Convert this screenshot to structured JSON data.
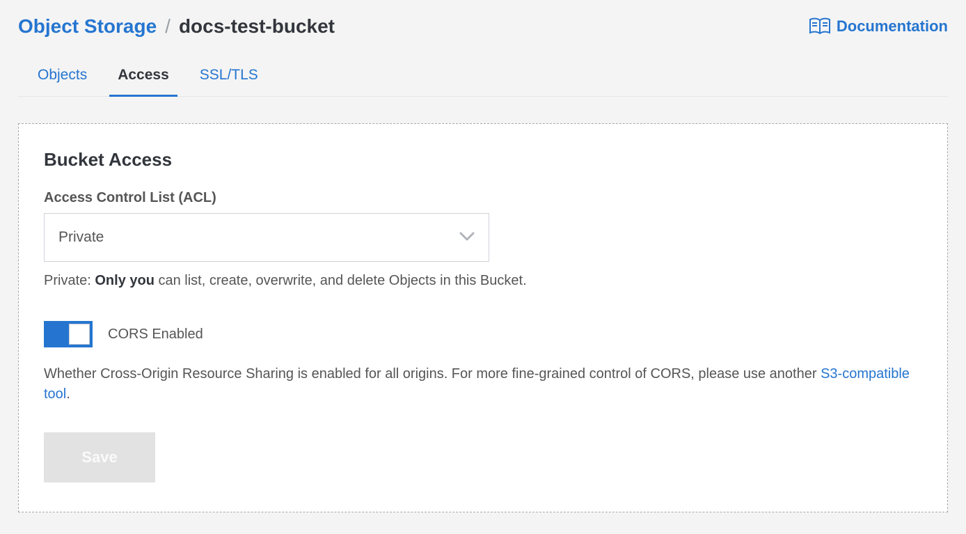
{
  "breadcrumb": {
    "root": "Object Storage",
    "separator": "/",
    "current": "docs-test-bucket"
  },
  "header": {
    "doc_link": "Documentation"
  },
  "tabs": [
    {
      "label": "Objects",
      "active": false
    },
    {
      "label": "Access",
      "active": true
    },
    {
      "label": "SSL/TLS",
      "active": false
    }
  ],
  "panel": {
    "title": "Bucket Access",
    "acl": {
      "label": "Access Control List (ACL)",
      "selected": "Private",
      "helper_prefix": "Private: ",
      "helper_strong": "Only you",
      "helper_rest": " can list, create, overwrite, and delete Objects in this Bucket."
    },
    "cors": {
      "enabled": true,
      "toggle_label": "CORS Enabled",
      "desc_1": "Whether Cross-Origin Resource Sharing is enabled for all origins. For more fine-grained control of CORS, please use another ",
      "link_text": "S3-compatible tool",
      "desc_2": "."
    },
    "save_label": "Save"
  },
  "colors": {
    "accent": "#2575d0",
    "bg": "#f4f4f4"
  }
}
